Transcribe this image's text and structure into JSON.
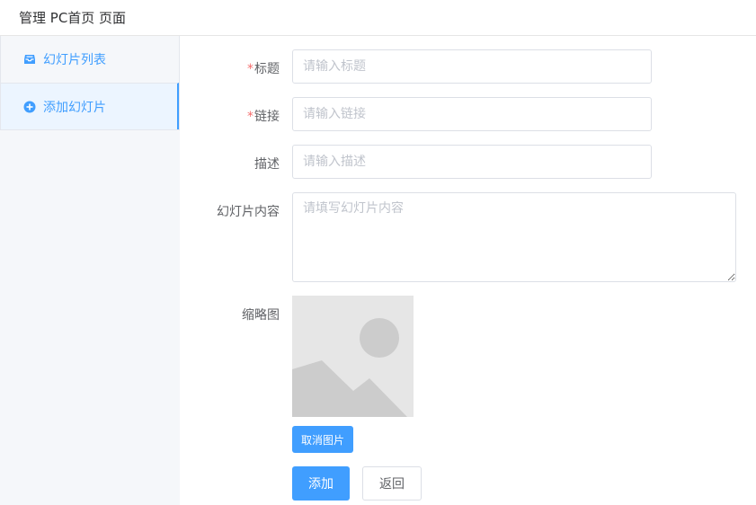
{
  "header": {
    "title": "管理 PC首页 页面"
  },
  "sidebar": {
    "items": [
      {
        "label": "幻灯片列表",
        "icon": "inbox-icon",
        "active": false
      },
      {
        "label": "添加幻灯片",
        "icon": "plus-circle-icon",
        "active": true
      }
    ]
  },
  "form": {
    "required_mark": "*",
    "title": {
      "label": "标题",
      "placeholder": "请输入标题",
      "value": ""
    },
    "link": {
      "label": "链接",
      "placeholder": "请输入链接",
      "value": ""
    },
    "description": {
      "label": "描述",
      "placeholder": "请输入描述",
      "value": ""
    },
    "content": {
      "label": "幻灯片内容",
      "placeholder": "请填写幻灯片内容",
      "value": ""
    },
    "thumbnail": {
      "label": "缩略图",
      "icon": "image-placeholder-icon"
    },
    "cancel_image_label": "取消图片",
    "submit_label": "添加",
    "back_label": "返回"
  },
  "colors": {
    "primary": "#409eff",
    "required": "#f56c6c",
    "border": "#dcdfe6",
    "sidebar_bg": "#f5f7fa"
  }
}
